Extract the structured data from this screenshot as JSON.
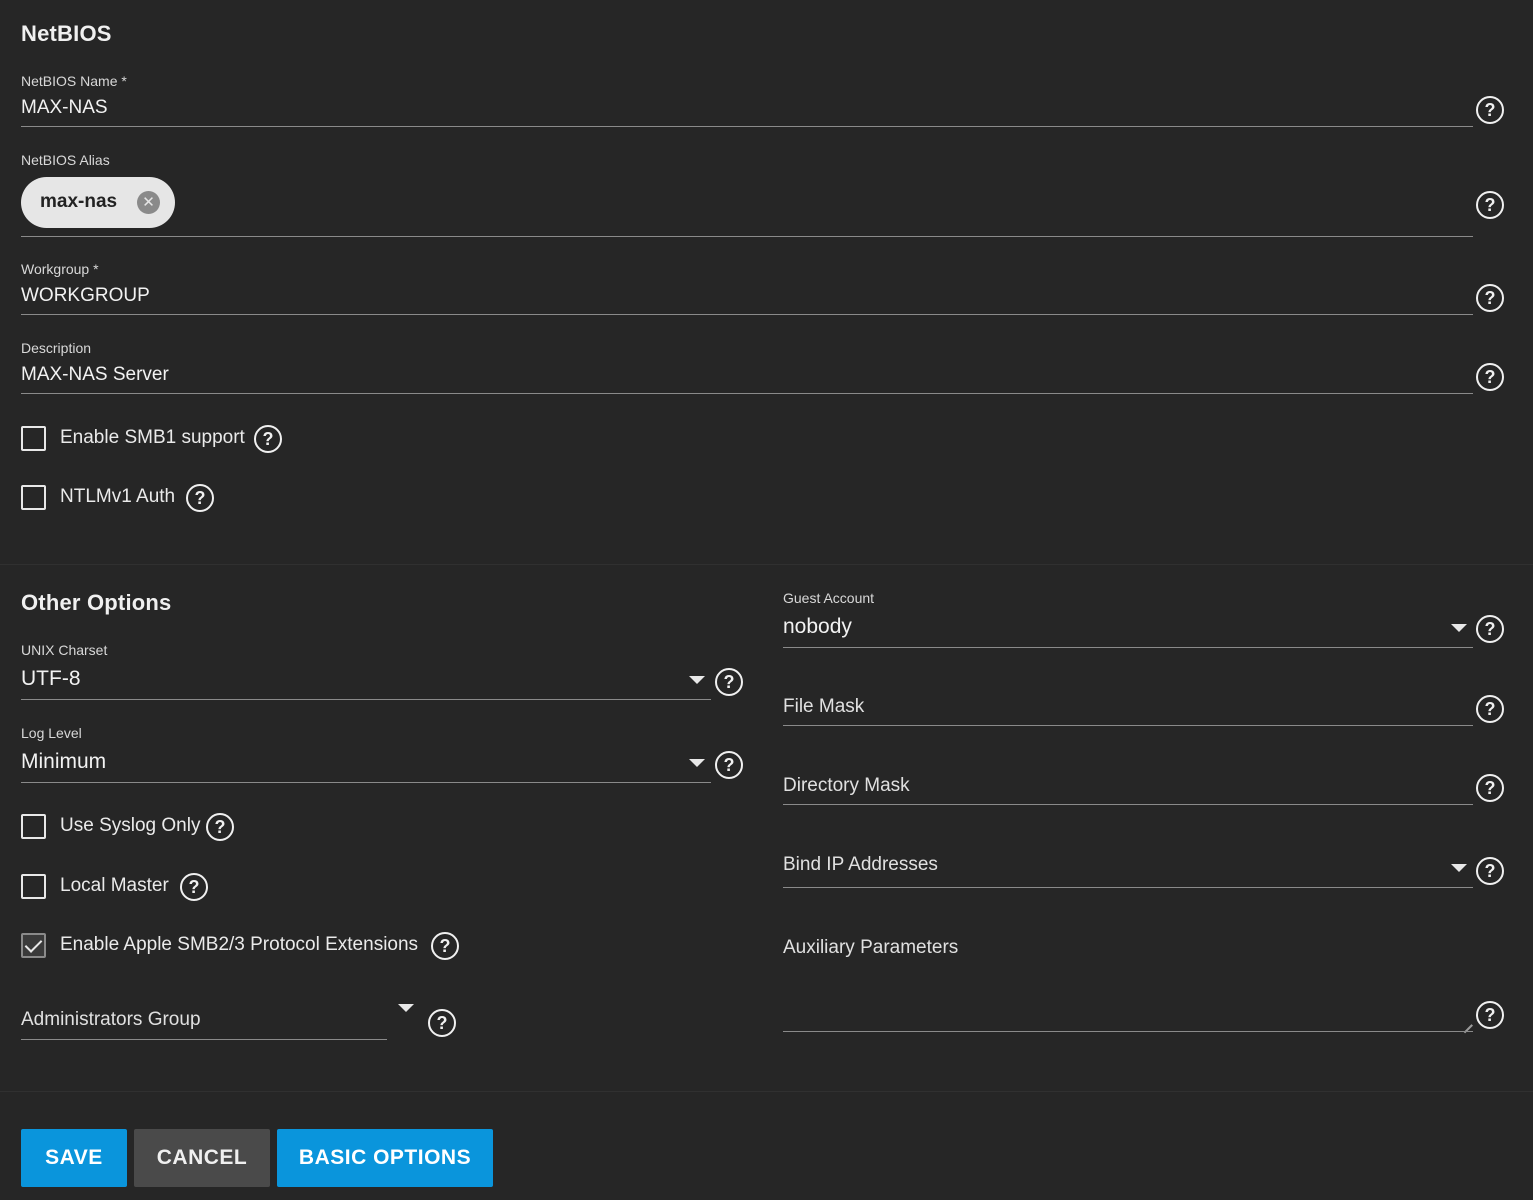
{
  "netbios": {
    "title": "NetBIOS",
    "name": {
      "label": "NetBIOS Name *",
      "value": "MAX-NAS"
    },
    "alias": {
      "label": "NetBIOS Alias",
      "chips": [
        "max-nas"
      ]
    },
    "workgroup": {
      "label": "Workgroup *",
      "value": "WORKGROUP"
    },
    "description": {
      "label": "Description",
      "value": "MAX-NAS Server"
    },
    "smb1": {
      "label": "Enable SMB1 support",
      "checked": false
    },
    "ntlmv1": {
      "label": "NTLMv1 Auth",
      "checked": false
    }
  },
  "other": {
    "title": "Other Options",
    "unix_charset": {
      "label": "UNIX Charset",
      "value": "UTF-8"
    },
    "log_level": {
      "label": "Log Level",
      "value": "Minimum"
    },
    "syslog_only": {
      "label": "Use Syslog Only",
      "checked": false
    },
    "local_master": {
      "label": "Local Master",
      "checked": false
    },
    "apple_ext": {
      "label": "Enable Apple SMB2/3 Protocol Extensions",
      "checked": true
    },
    "admin_group": {
      "placeholder": "Administrators Group"
    },
    "guest_account": {
      "label": "Guest Account",
      "value": "nobody"
    },
    "file_mask": {
      "placeholder": "File Mask"
    },
    "directory_mask": {
      "placeholder": "Directory Mask"
    },
    "bind_ip": {
      "placeholder": "Bind IP Addresses"
    },
    "aux_params": {
      "placeholder": "Auxiliary Parameters"
    }
  },
  "help_glyph": "?",
  "icons": {
    "help": "help-circle-icon",
    "dropdown": "arrow-drop-down-icon",
    "remove": "cancel-circle-icon"
  },
  "actions": {
    "save": "SAVE",
    "cancel": "CANCEL",
    "basic": "BASIC OPTIONS"
  },
  "colors": {
    "background": "#262626",
    "primary": "#0a95dc",
    "secondary": "#4a4a4a",
    "chip": "#e6e6e6"
  }
}
